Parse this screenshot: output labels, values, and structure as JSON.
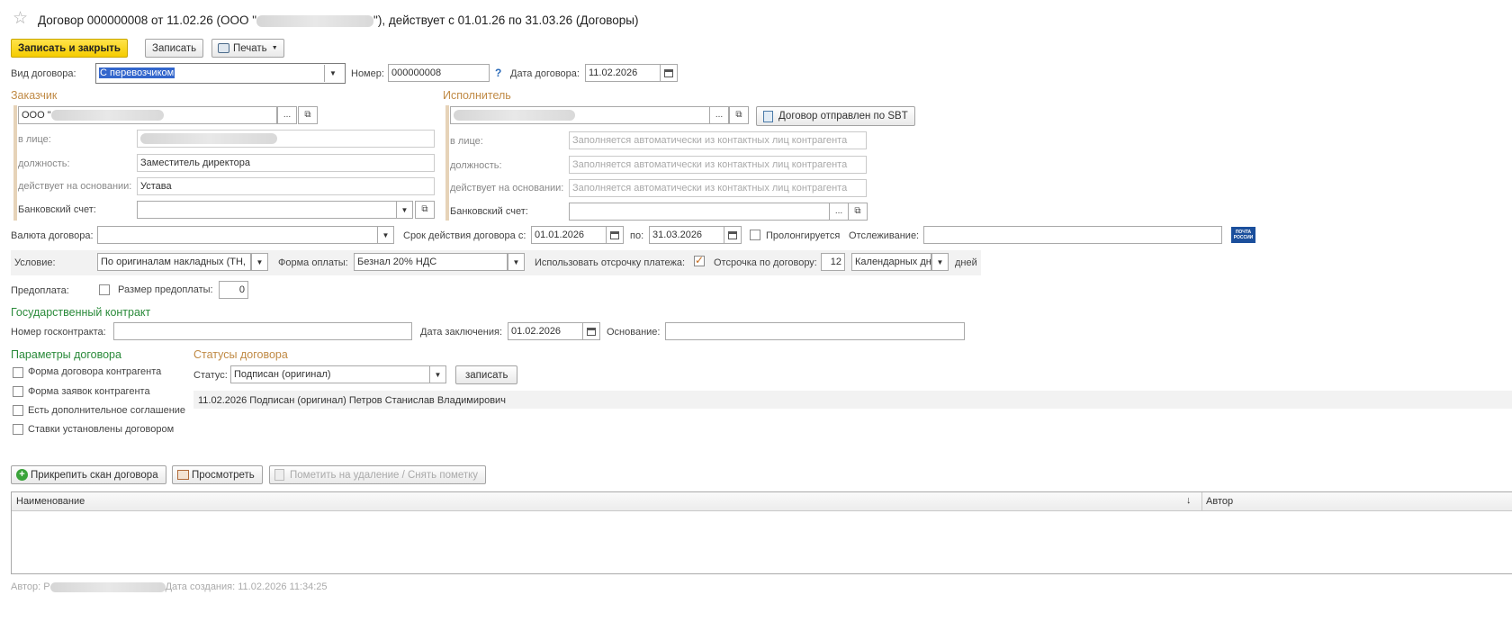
{
  "window": {
    "title_prefix": "Договор 000000008 от 11.02.26 (ООО \"",
    "title_suffix": "\"), действует с 01.01.26 по 31.03.26 (Договоры)"
  },
  "toolbar": {
    "save_close": "Записать и закрыть",
    "save": "Записать",
    "print": "Печать"
  },
  "contract": {
    "type_label": "Вид договора:",
    "type_value": "С перевозчиком",
    "number_label": "Номер:",
    "number_value": "000000008",
    "help": "?",
    "date_label": "Дата договора:",
    "date_value": "11.02.2026"
  },
  "customer": {
    "header": "Заказчик",
    "name_prefix": "ООО \"",
    "person_label": "в лице:",
    "position_label": "должность:",
    "position_value": "Заместитель директора",
    "basis_label": "действует на основании:",
    "basis_value": "Устава",
    "bank_label": "Банковский счет:",
    "more_button": "..."
  },
  "executor": {
    "header": "Исполнитель",
    "sent_button": "Договор отправлен по SBT",
    "person_label": "в лице:",
    "person_placeholder": "Заполняется автоматически из контактных лиц контрагента",
    "position_label": "должность:",
    "position_placeholder": "Заполняется автоматически из контактных лиц контрагента",
    "basis_label": "действует на основании:",
    "basis_placeholder": "Заполняется автоматически из контактных лиц контрагента",
    "bank_label": "Банковский счет:",
    "more_button": "..."
  },
  "terms": {
    "currency_label": "Валюта договора:",
    "period_label": "Срок действия договора с:",
    "period_from": "01.01.2026",
    "period_to_label": "по:",
    "period_to": "31.03.2026",
    "prolong_label": "Пролонгируется",
    "tracking_label": "Отслеживание:",
    "post_logo_line1": "ПОЧТА",
    "post_logo_line2": "РОССИИ",
    "condition_label": "Условие:",
    "condition_value": "По оригиналам накладных (ТН,",
    "payment_form_label": "Форма оплаты:",
    "payment_form_value": "Безнал 20% НДС",
    "use_deferral_label": "Использовать отсрочку платежа:",
    "deferral_label": "Отсрочка по договору:",
    "deferral_value": "12",
    "day_type_value": "Календарных дн",
    "days_label": "дней",
    "prepay_label": "Предоплата:",
    "prepay_size_label": "Размер предоплаты:",
    "prepay_size_value": "0"
  },
  "gov": {
    "header": "Государственный контракт",
    "number_label": "Номер госконтракта:",
    "date_label": "Дата заключения:",
    "date_value": "01.02.2026",
    "basis_label": "Основание:"
  },
  "params": {
    "header": "Параметры договора",
    "items": [
      "Форма договора контрагента",
      "Форма заявок контрагента",
      "Есть дополнительное соглашение",
      "Ставки установлены договором"
    ]
  },
  "statuses": {
    "header": "Статусы договора",
    "status_label": "Статус:",
    "status_value": "Подписан (оригинал)",
    "write_button": "записать",
    "history": "11.02.2026 Подписан (оригинал) Петров Станислав Владимирович"
  },
  "attachments": {
    "attach_button": "Прикрепить скан договора",
    "view_button": "Просмотреть",
    "mark_delete_button": "Пометить на удаление / Снять пометку",
    "col_name": "Наименование",
    "col_author": "Автор",
    "sort_icon": "↓"
  },
  "footer": {
    "author_label": "Автор:",
    "author_initial": "Р",
    "created_text": "Дата создания: 11.02.2026 11:34:25"
  },
  "colors": {
    "accent_yellow": "#f5cc00",
    "section_orange": "#c08a45",
    "section_green": "#2a8a3a",
    "selection_blue": "#3366cc",
    "post_blue": "#1b4f9c"
  }
}
